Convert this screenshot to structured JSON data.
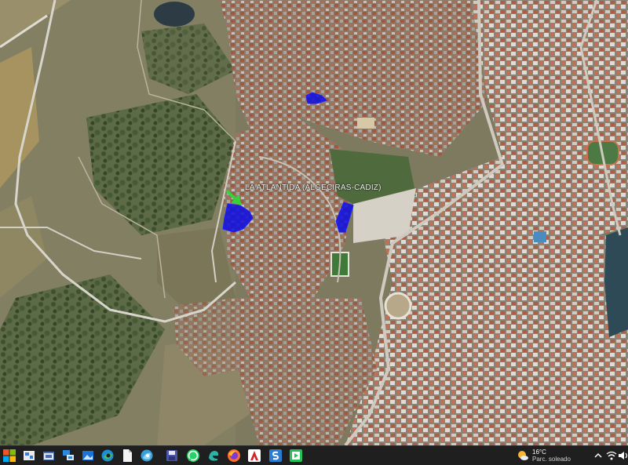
{
  "map": {
    "label": "LA ATLANTIDA (ALGECIRAS-CADIZ)",
    "highlight_color": "#1010e0",
    "marker_color": "#37d23a"
  },
  "taskbar": {
    "icons": [
      "windows-start-icon",
      "task-view-icon",
      "folder-icon",
      "network-icon",
      "photos-icon",
      "edge-icon",
      "file-icon",
      "maps-icon",
      "save-icon",
      "whatsapp-icon",
      "edge-dev-icon",
      "firefox-icon",
      "acrobat-icon",
      "sway-icon",
      "media-icon"
    ],
    "weather": {
      "temperature": "16°C",
      "description": "Parc. soleado"
    }
  }
}
